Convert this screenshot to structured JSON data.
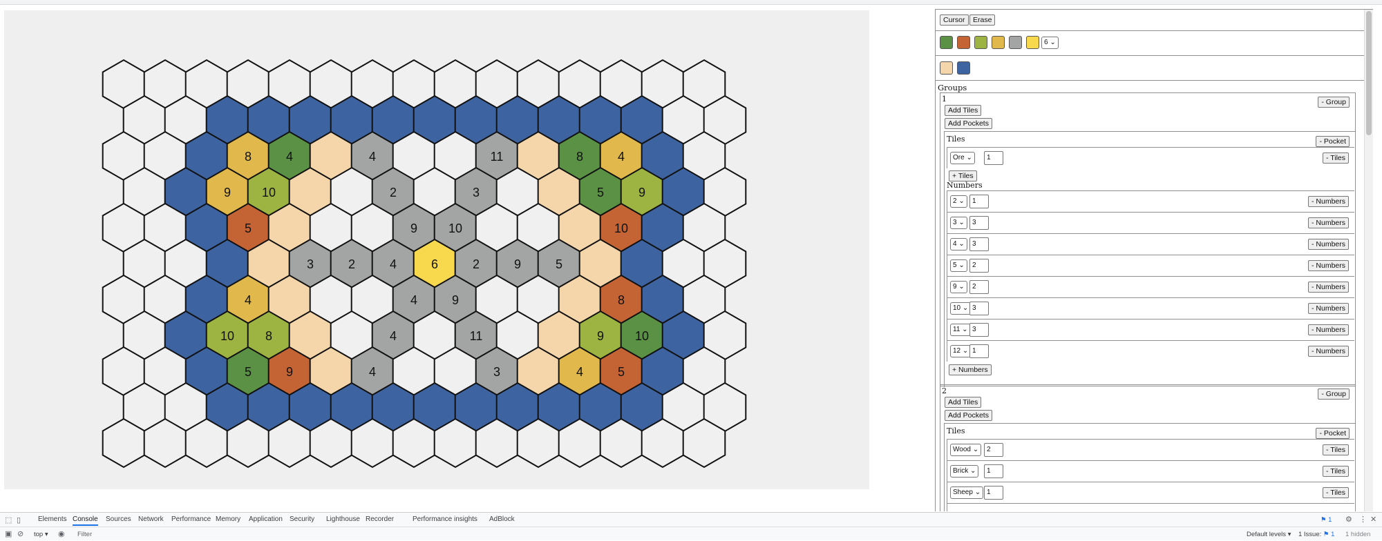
{
  "colors": {
    "background": "#efefef",
    "empty": "#f0f0f0",
    "sea": "#3d63a0",
    "forest": "#5a9145",
    "brick": "#c46334",
    "wheat": "#9db342",
    "sheep": "#e1b84c",
    "ore": "#a2a5a3",
    "gold": "#f8d94e",
    "desert": "#f5d6ab"
  },
  "board": {
    "columns": 15,
    "rows": 11,
    "rows_cells": [
      [
        [
          "empty",
          ""
        ],
        [
          "empty",
          ""
        ],
        [
          "empty",
          ""
        ],
        [
          "empty",
          ""
        ],
        [
          "empty",
          ""
        ],
        [
          "empty",
          ""
        ],
        [
          "empty",
          ""
        ],
        [
          "empty",
          ""
        ],
        [
          "empty",
          ""
        ],
        [
          "empty",
          ""
        ],
        [
          "empty",
          ""
        ],
        [
          "empty",
          ""
        ],
        [
          "empty",
          ""
        ],
        [
          "empty",
          ""
        ],
        [
          "empty",
          ""
        ]
      ],
      [
        [
          "empty",
          ""
        ],
        [
          "empty",
          ""
        ],
        [
          "sea",
          ""
        ],
        [
          "sea",
          ""
        ],
        [
          "sea",
          ""
        ],
        [
          "sea",
          ""
        ],
        [
          "sea",
          ""
        ],
        [
          "sea",
          ""
        ],
        [
          "sea",
          ""
        ],
        [
          "sea",
          ""
        ],
        [
          "sea",
          ""
        ],
        [
          "sea",
          ""
        ],
        [
          "sea",
          ""
        ],
        [
          "empty",
          ""
        ],
        [
          "empty",
          ""
        ]
      ],
      [
        [
          "empty",
          ""
        ],
        [
          "empty",
          ""
        ],
        [
          "sea",
          ""
        ],
        [
          "sheep",
          "8"
        ],
        [
          "forest",
          "4"
        ],
        [
          "desert",
          ""
        ],
        [
          "ore",
          "4"
        ],
        [
          "empty",
          ""
        ],
        [
          "empty",
          ""
        ],
        [
          "ore",
          "11"
        ],
        [
          "desert",
          ""
        ],
        [
          "forest",
          "8"
        ],
        [
          "sheep",
          "4"
        ],
        [
          "sea",
          ""
        ],
        [
          "empty",
          ""
        ]
      ],
      [
        [
          "empty",
          ""
        ],
        [
          "sea",
          ""
        ],
        [
          "sheep",
          "9"
        ],
        [
          "wheat",
          "10"
        ],
        [
          "desert",
          ""
        ],
        [
          "empty",
          ""
        ],
        [
          "ore",
          "2"
        ],
        [
          "empty",
          ""
        ],
        [
          "ore",
          "3"
        ],
        [
          "empty",
          ""
        ],
        [
          "desert",
          ""
        ],
        [
          "forest",
          "5"
        ],
        [
          "wheat",
          "9"
        ],
        [
          "sea",
          ""
        ],
        [
          "empty",
          ""
        ]
      ],
      [
        [
          "empty",
          ""
        ],
        [
          "empty",
          ""
        ],
        [
          "sea",
          ""
        ],
        [
          "brick",
          "5"
        ],
        [
          "desert",
          ""
        ],
        [
          "empty",
          ""
        ],
        [
          "empty",
          ""
        ],
        [
          "ore",
          "9"
        ],
        [
          "ore",
          "10"
        ],
        [
          "empty",
          ""
        ],
        [
          "empty",
          ""
        ],
        [
          "desert",
          ""
        ],
        [
          "brick",
          "10"
        ],
        [
          "sea",
          ""
        ],
        [
          "empty",
          ""
        ]
      ],
      [
        [
          "empty",
          ""
        ],
        [
          "empty",
          ""
        ],
        [
          "sea",
          ""
        ],
        [
          "desert",
          ""
        ],
        [
          "ore",
          "3"
        ],
        [
          "ore",
          "2"
        ],
        [
          "ore",
          "4"
        ],
        [
          "gold",
          "6"
        ],
        [
          "ore",
          "2"
        ],
        [
          "ore",
          "9"
        ],
        [
          "ore",
          "5"
        ],
        [
          "desert",
          ""
        ],
        [
          "sea",
          ""
        ],
        [
          "empty",
          ""
        ],
        [
          "empty",
          ""
        ]
      ],
      [
        [
          "empty",
          ""
        ],
        [
          "empty",
          ""
        ],
        [
          "sea",
          ""
        ],
        [
          "sheep",
          "4"
        ],
        [
          "desert",
          ""
        ],
        [
          "empty",
          ""
        ],
        [
          "empty",
          ""
        ],
        [
          "ore",
          "4"
        ],
        [
          "ore",
          "9"
        ],
        [
          "empty",
          ""
        ],
        [
          "empty",
          ""
        ],
        [
          "desert",
          ""
        ],
        [
          "brick",
          "8"
        ],
        [
          "sea",
          ""
        ],
        [
          "empty",
          ""
        ]
      ],
      [
        [
          "empty",
          ""
        ],
        [
          "sea",
          ""
        ],
        [
          "wheat",
          "10"
        ],
        [
          "wheat",
          "8"
        ],
        [
          "desert",
          ""
        ],
        [
          "empty",
          ""
        ],
        [
          "ore",
          "4"
        ],
        [
          "empty",
          ""
        ],
        [
          "ore",
          "11"
        ],
        [
          "empty",
          ""
        ],
        [
          "desert",
          ""
        ],
        [
          "wheat",
          "9"
        ],
        [
          "forest",
          "10"
        ],
        [
          "sea",
          ""
        ],
        [
          "empty",
          ""
        ]
      ],
      [
        [
          "empty",
          ""
        ],
        [
          "empty",
          ""
        ],
        [
          "sea",
          ""
        ],
        [
          "forest",
          "5"
        ],
        [
          "brick",
          "9"
        ],
        [
          "desert",
          ""
        ],
        [
          "ore",
          "4"
        ],
        [
          "empty",
          ""
        ],
        [
          "empty",
          ""
        ],
        [
          "ore",
          "3"
        ],
        [
          "desert",
          ""
        ],
        [
          "sheep",
          "4"
        ],
        [
          "brick",
          "5"
        ],
        [
          "sea",
          ""
        ],
        [
          "empty",
          ""
        ]
      ],
      [
        [
          "empty",
          ""
        ],
        [
          "empty",
          ""
        ],
        [
          "sea",
          ""
        ],
        [
          "sea",
          ""
        ],
        [
          "sea",
          ""
        ],
        [
          "sea",
          ""
        ],
        [
          "sea",
          ""
        ],
        [
          "sea",
          ""
        ],
        [
          "sea",
          ""
        ],
        [
          "sea",
          ""
        ],
        [
          "sea",
          ""
        ],
        [
          "sea",
          ""
        ],
        [
          "sea",
          ""
        ],
        [
          "empty",
          ""
        ],
        [
          "empty",
          ""
        ]
      ],
      [
        [
          "empty",
          ""
        ],
        [
          "empty",
          ""
        ],
        [
          "empty",
          ""
        ],
        [
          "empty",
          ""
        ],
        [
          "empty",
          ""
        ],
        [
          "empty",
          ""
        ],
        [
          "empty",
          ""
        ],
        [
          "empty",
          ""
        ],
        [
          "empty",
          ""
        ],
        [
          "empty",
          ""
        ],
        [
          "empty",
          ""
        ],
        [
          "empty",
          ""
        ],
        [
          "empty",
          ""
        ],
        [
          "empty",
          ""
        ],
        [
          "empty",
          ""
        ]
      ]
    ]
  },
  "toolbar": {
    "cursor_label": "Cursor",
    "erase_label": "Erase"
  },
  "palette": {
    "swatches": [
      "forest",
      "brick",
      "wheat",
      "sheep",
      "ore",
      "gold"
    ],
    "select_value": "6",
    "swatches_row2": [
      "desert",
      "sea"
    ]
  },
  "groups": {
    "heading": "Groups",
    "list": [
      {
        "id": "1",
        "remove_group_label": "- Group",
        "add_tiles_label": "Add Tiles",
        "add_pockets_label": "Add Pockets",
        "tiles_heading": "Tiles",
        "remove_pocket_label": "- Pocket",
        "tile_rows": [
          {
            "type": "Ore",
            "count": "1",
            "remove_label": "- Tiles"
          }
        ],
        "add_tile_label": "+ Tiles",
        "numbers_heading": "Numbers",
        "number_rows": [
          {
            "number": "2",
            "count": "1",
            "remove_label": "- Numbers"
          },
          {
            "number": "3",
            "count": "3",
            "remove_label": "- Numbers"
          },
          {
            "number": "4",
            "count": "3",
            "remove_label": "- Numbers"
          },
          {
            "number": "5",
            "count": "2",
            "remove_label": "- Numbers"
          },
          {
            "number": "9",
            "count": "2",
            "remove_label": "- Numbers"
          },
          {
            "number": "10",
            "count": "3",
            "remove_label": "- Numbers"
          },
          {
            "number": "11",
            "count": "3",
            "remove_label": "- Numbers"
          },
          {
            "number": "12",
            "count": "1",
            "remove_label": "- Numbers"
          }
        ],
        "add_number_label": "+ Numbers"
      },
      {
        "id": "2",
        "remove_group_label": "- Group",
        "add_tiles_label": "Add Tiles",
        "add_pockets_label": "Add Pockets",
        "tiles_heading": "Tiles",
        "remove_pocket_label": "- Pocket",
        "tile_rows": [
          {
            "type": "Wood",
            "count": "2",
            "remove_label": "- Tiles"
          },
          {
            "type": "Brick",
            "count": "1",
            "remove_label": "- Tiles"
          },
          {
            "type": "Sheep",
            "count": "1",
            "remove_label": "- Tiles"
          }
        ]
      }
    ]
  },
  "devtools": {
    "tabs": [
      "Elements",
      "Console",
      "Sources",
      "Network",
      "Performance",
      "Memory",
      "Application",
      "Security",
      "Lighthouse",
      "Recorder",
      "Performance insights",
      "AdBlock"
    ],
    "active_tab": "Console",
    "issues_badge": "1",
    "context": "top",
    "filter_placeholder": "Filter",
    "levels": "Default levels",
    "issue_count": "1 Issue:",
    "issue_badge_count": "1",
    "hidden": "1 hidden"
  }
}
